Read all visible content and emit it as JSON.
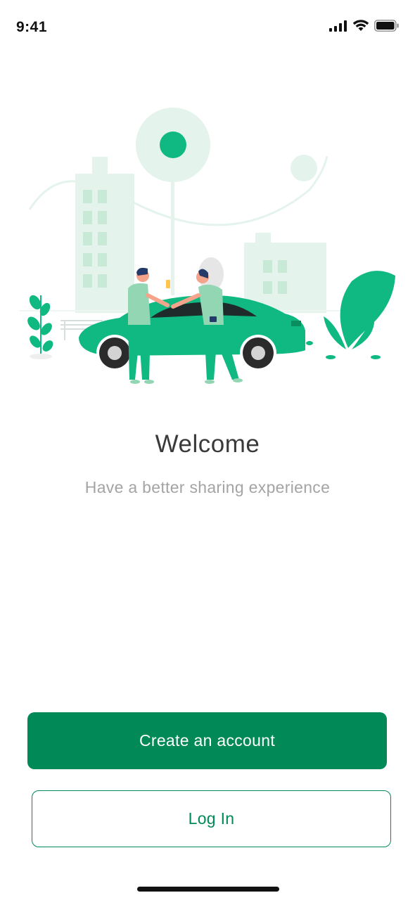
{
  "status_bar": {
    "time": "9:41",
    "icons": [
      "cellular-signal-icon",
      "wifi-icon",
      "battery-icon"
    ]
  },
  "hero": {
    "illustration": "car-sharing-illustration"
  },
  "welcome": {
    "title": "Welcome",
    "subtitle": "Have a better sharing experience"
  },
  "actions": {
    "create_account_label": "Create an account",
    "login_label": "Log In"
  },
  "colors": {
    "primary": "#018a57",
    "accent_green": "#10b981",
    "light_green": "#e4f4ec",
    "title_text": "#3a3a3a",
    "subtitle_text": "#a4a4a4"
  }
}
